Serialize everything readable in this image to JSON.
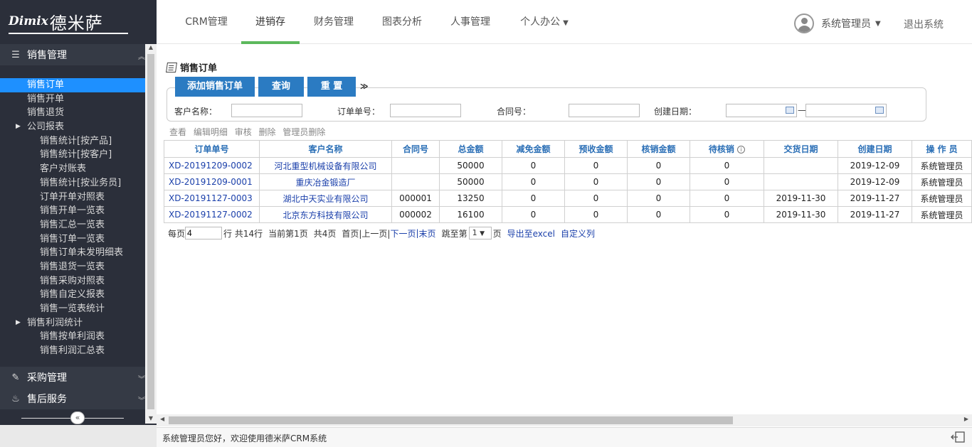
{
  "logo": {
    "latin": "Dimix",
    "cn": "德米萨"
  },
  "sidebar": {
    "groups": [
      {
        "label": "销售管理",
        "icon": "list-icon"
      },
      {
        "label": "采购管理",
        "icon": "edit-icon"
      },
      {
        "label": "售后服务",
        "icon": "fire-icon"
      }
    ],
    "items": [
      {
        "label": "销售订单",
        "level": 1,
        "active": true
      },
      {
        "label": "销售开单",
        "level": 1
      },
      {
        "label": "销售退货",
        "level": 1
      },
      {
        "label": "公司报表",
        "level": 1,
        "expandable": true
      },
      {
        "label": "销售统计[按产品]",
        "level": 2
      },
      {
        "label": "销售统计[按客户]",
        "level": 2
      },
      {
        "label": "客户对账表",
        "level": 2
      },
      {
        "label": "销售统计[按业务员]",
        "level": 2
      },
      {
        "label": "订单开单对照表",
        "level": 2
      },
      {
        "label": "销售开单一览表",
        "level": 2
      },
      {
        "label": "销售汇总一览表",
        "level": 2
      },
      {
        "label": "销售订单一览表",
        "level": 2
      },
      {
        "label": "销售订单未发明细表",
        "level": 2
      },
      {
        "label": "销售退货一览表",
        "level": 2
      },
      {
        "label": "销售采购对照表",
        "level": 2
      },
      {
        "label": "销售自定义报表",
        "level": 2
      },
      {
        "label": "销售一览表统计",
        "level": 2
      },
      {
        "label": "销售利润统计",
        "level": 1,
        "expandable": true
      },
      {
        "label": "销售按单利润表",
        "level": 2
      },
      {
        "label": "销售利润汇总表",
        "level": 2
      }
    ],
    "collapse_label": "«"
  },
  "topnav": {
    "tabs": [
      "CRM管理",
      "进销存",
      "财务管理",
      "图表分析",
      "人事管理",
      "个人办公"
    ],
    "active_tab": "进销存",
    "user": "系统管理员",
    "logout": "退出系统"
  },
  "page": {
    "title": "销售订单",
    "buttons": {
      "add": "添加销售订单",
      "query": "查询",
      "reset": "重 置"
    },
    "filters": {
      "customer_label": "客户名称：",
      "order_no_label": "订单单号：",
      "contract_label": "合同号：",
      "date_label": "创建日期：",
      "date_sep": "—"
    },
    "actions": [
      "查看",
      "编辑明细",
      "审核",
      "删除",
      "管理员删除"
    ],
    "table": {
      "headers": [
        "订单单号",
        "客户名称",
        "合同号",
        "总金额",
        "减免金额",
        "预收金额",
        "核销金额",
        "待核销",
        "交货日期",
        "创建日期",
        "操 作 员"
      ],
      "rows": [
        [
          "XD-20191209-0002",
          "河北重型机械设备有限公司",
          "",
          "50000",
          "0",
          "0",
          "0",
          "0",
          "",
          "2019-12-09",
          "系统管理员"
        ],
        [
          "XD-20191209-0001",
          "重庆冶金锻造厂",
          "",
          "50000",
          "0",
          "0",
          "0",
          "0",
          "",
          "2019-12-09",
          "系统管理员"
        ],
        [
          "XD-20191127-0003",
          "湖北中天实业有限公司",
          "000001",
          "13250",
          "0",
          "0",
          "0",
          "0",
          "2019-11-30",
          "2019-11-27",
          "系统管理员"
        ],
        [
          "XD-20191127-0002",
          "北京东方科技有限公司",
          "000002",
          "16100",
          "0",
          "0",
          "0",
          "0",
          "2019-11-30",
          "2019-11-27",
          "系统管理员"
        ]
      ]
    },
    "pager": {
      "per_page_label": "每页",
      "per_page_value": "4",
      "rows_total": "行 共14行",
      "current": "当前第1页",
      "pages": "共4页",
      "first_prev": "首页|上一页|",
      "next": "下一页",
      "sep": "|",
      "last": "末页",
      "jump_label": "跳至第",
      "jump_value": "1",
      "page_suffix": "页",
      "export": "导出至excel",
      "custom_cols": "自定义列"
    }
  },
  "statusbar": {
    "welcome": "系统管理员您好，欢迎使用德米萨CRM系统"
  },
  "colors": {
    "sidebar_bg": "#2b2f3a",
    "active_item": "#1e90ff",
    "primary_button": "#2b7bc2",
    "tab_underline": "#5cb85c",
    "header_text": "#2b6fb6"
  }
}
